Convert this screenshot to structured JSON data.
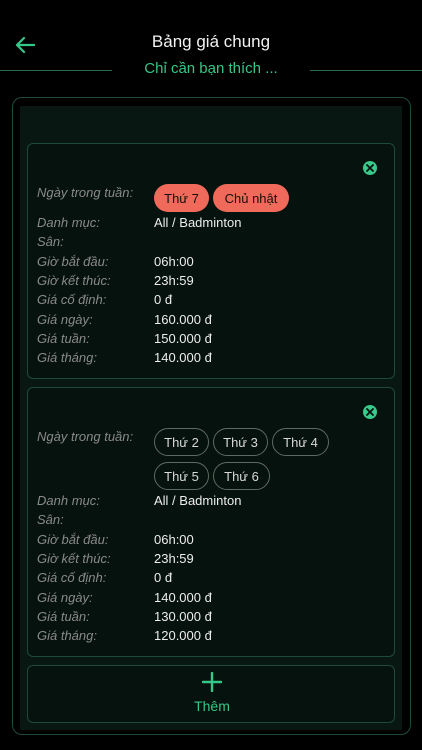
{
  "header": {
    "title": "Bảng giá chung",
    "subtitle": "Chỉ cần bạn thích ..."
  },
  "labels": {
    "days": "Ngày trong tuần:",
    "category": "Danh mục:",
    "court": "Sân:",
    "start": "Giờ bắt đầu:",
    "end": "Giờ kết thúc:",
    "fixed": "Giá cố định:",
    "daily": "Giá ngày:",
    "weekly": "Giá tuần:",
    "monthly": "Giá tháng:"
  },
  "cards": [
    {
      "days": [
        "Thứ 7",
        "Chủ nhật"
      ],
      "category": "All / Badminton",
      "court": "",
      "start": "06h:00",
      "end": "23h:59",
      "fixed": "0 đ",
      "daily": "160.000 đ",
      "weekly": "150.000 đ",
      "monthly": "140.000 đ"
    },
    {
      "days": [
        "Thứ 2",
        "Thứ 3",
        "Thứ 4",
        "Thứ 5",
        "Thứ 6"
      ],
      "category": "All / Badminton",
      "court": "",
      "start": "06h:00",
      "end": "23h:59",
      "fixed": "0 đ",
      "daily": "140.000 đ",
      "weekly": "130.000 đ",
      "monthly": "120.000 đ"
    }
  ],
  "add_button": {
    "label": "Thêm"
  },
  "colors": {
    "accent": "#35c787",
    "chip_selected": "#ef6a5b",
    "background": "#000000"
  },
  "icons": {
    "back": "arrow-left-icon",
    "remove": "close-circle-icon",
    "add": "plus-icon"
  }
}
